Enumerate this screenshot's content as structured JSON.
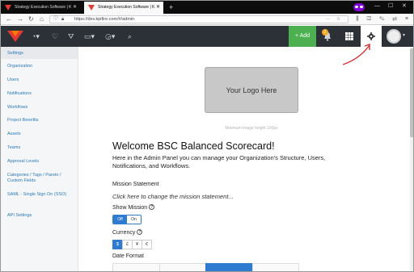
{
  "browser": {
    "tabs": [
      {
        "title": "Strategy Execution Software | K"
      },
      {
        "title": "Strategy Execution Software | K"
      }
    ],
    "url": "https://dev.kpifire.com/#/admin"
  },
  "header": {
    "add_label": "+ Add",
    "notification_count": "2"
  },
  "sidebar": {
    "items": [
      {
        "label": "Settings"
      },
      {
        "label": "Organization"
      },
      {
        "label": "Users"
      },
      {
        "label": "Notifications"
      },
      {
        "label": "Workflows"
      },
      {
        "label": "Project Benefits"
      },
      {
        "label": "Assets"
      },
      {
        "label": "Teams"
      },
      {
        "label": "Approval Levels"
      },
      {
        "label": "Categories / Tags / Pareto / Custom Fields"
      },
      {
        "label": "SAML - Single Sign On (SSO)"
      },
      {
        "label": "API Settings"
      }
    ]
  },
  "main": {
    "logo_placeholder": "Your Logo Here",
    "logo_hint": "Minimum image height 100px",
    "title": "Welcome BSC Balanced Scorecard!",
    "intro": "Here in the Admin Panel you can manage your Organization's Structure, Users, Notifications, and Workflows.",
    "mission_label": "Mission Statement",
    "mission_placeholder": "Click here to change the mission statement...",
    "show_mission_label": "Show Mission",
    "toggle_off": "Off",
    "toggle_on": "On",
    "currency_label": "Currency",
    "currencies": [
      "$",
      "£",
      "¥",
      "€"
    ],
    "date_format_label": "Date Format",
    "help_glyph": "?"
  },
  "colors": {
    "header_bg": "#2c3138",
    "add_green": "#4caf50",
    "accent_blue": "#2e7bcf",
    "link_blue": "#2a7ab9",
    "annotation_red": "#d32f2f"
  }
}
